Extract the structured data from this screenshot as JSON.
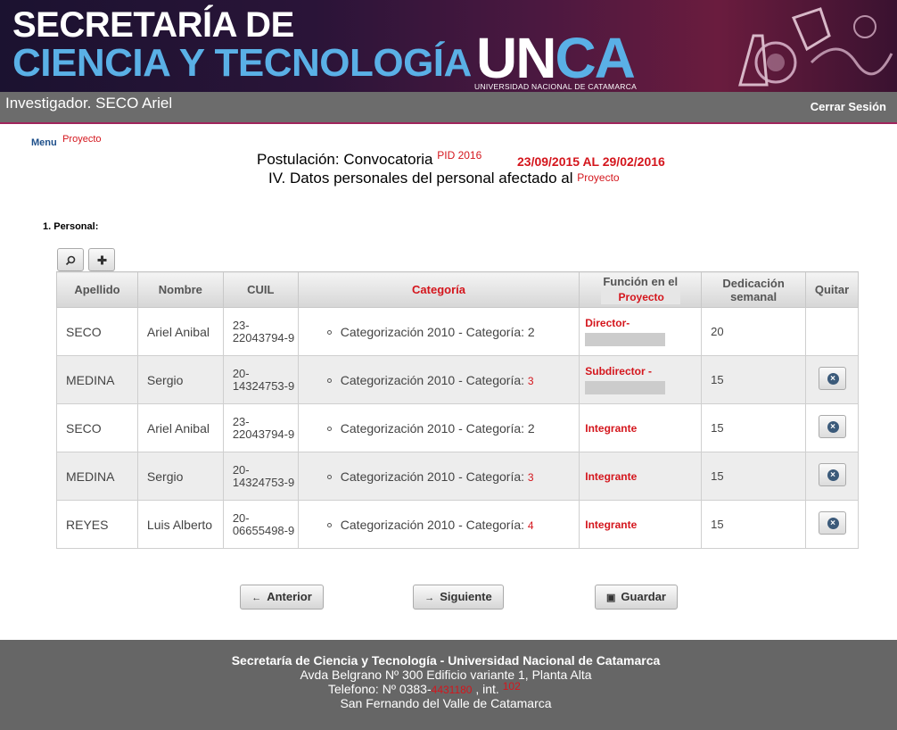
{
  "header": {
    "title_line1": "SECRETARÍA DE",
    "title_line2": "CIENCIA Y TECNOLOGÍA",
    "logo_un": "UN",
    "logo_ca": "CA",
    "logo_sub": "UNIVERSIDAD NACIONAL DE CATAMARCA"
  },
  "userbar": {
    "user": "Investigador. SECO Ariel",
    "logout": "Cerrar Sesión"
  },
  "breadcrumb": {
    "menu": "Menu",
    "project": "Proyecto"
  },
  "page": {
    "title_prefix": "Postulación: Convocatoria",
    "call_code": "PID 2016",
    "dates": "23/09/2015 AL 29/02/2016",
    "subtitle": "IV. Datos personales del personal afectado al",
    "subtitle_target": "Proyecto",
    "section_label": "1.  Personal:"
  },
  "toolbar": {
    "search_icon": "search-icon",
    "add_icon": "plus-icon"
  },
  "table": {
    "headers": {
      "apellido": "Apellido",
      "nombre": "Nombre",
      "cuil": "CUIL",
      "categoria": "Categoría",
      "funcion": "Función en el",
      "funcion_sub": "Proyecto",
      "dedicacion": "Dedicación semanal",
      "quitar": "Quitar"
    },
    "rows": [
      {
        "apellido": "SECO",
        "nombre": "Ariel Anibal",
        "cuil": "23-22043794-9",
        "categoria": "Categorización 2010 - Categoría: 2",
        "cat_num": "",
        "funcion": "Director-",
        "dedicacion": "20"
      },
      {
        "apellido": "MEDINA",
        "nombre": "Sergio",
        "cuil": "20-14324753-9",
        "categoria": "Categorización 2010 - Categoría:",
        "cat_num": "3",
        "funcion": "Subdirector  -",
        "dedicacion": "15"
      },
      {
        "apellido": "SECO",
        "nombre": "Ariel Anibal",
        "cuil": "23-22043794-9",
        "categoria": "Categorización 2010 - Categoría: 2",
        "cat_num": "",
        "funcion": "Integrante",
        "dedicacion": "15"
      },
      {
        "apellido": "MEDINA",
        "nombre": "Sergio",
        "cuil": "20-14324753-9",
        "categoria": "Categorización 2010 - Categoría:",
        "cat_num": "3",
        "funcion": "Integrante",
        "dedicacion": "15"
      },
      {
        "apellido": "REYES",
        "nombre": "Luis Alberto",
        "cuil": "20-06655498-9",
        "categoria": "Categorización 2010 - Categoría:",
        "cat_num": "4",
        "funcion": "Integrante",
        "dedicacion": "15"
      }
    ]
  },
  "nav": {
    "prev": "Anterior",
    "next": "Siguiente",
    "save": "Guardar"
  },
  "footer": {
    "line1": "Secretaría de Ciencia y Tecnología - Universidad Nacional de Catamarca",
    "line2": "Avda Belgrano Nº 300 Edificio variante 1, Planta Alta",
    "phone_prefix": "Telefono: Nº 0383-",
    "phone_num": "4431180",
    "phone_int_label": ", int.",
    "phone_int": "102",
    "line4": "San Fernando del Valle de Catamarca"
  },
  "colors": {
    "accent_red": "#d4161d",
    "header_blue": "#5ab0e6",
    "bar_gray": "#6c6c6c"
  }
}
